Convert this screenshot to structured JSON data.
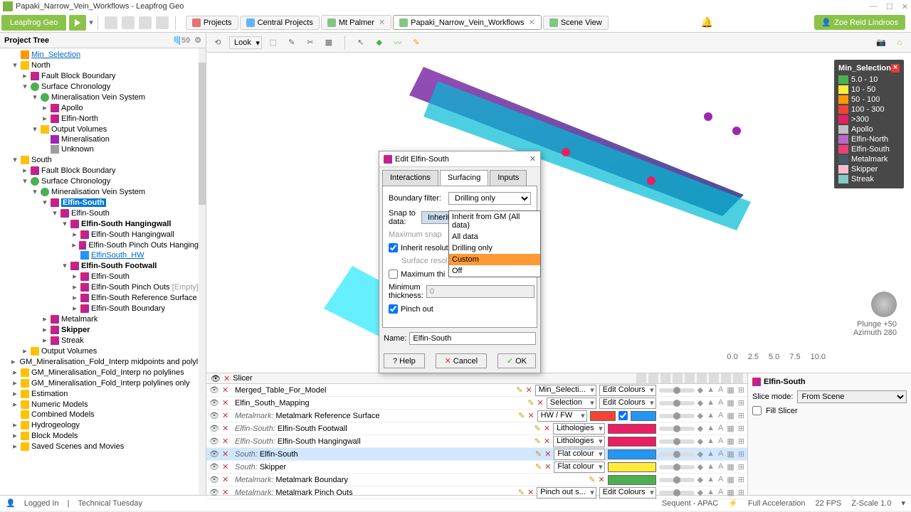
{
  "titlebar": {
    "text": "Papaki_Narrow_Vein_Workflows - Leapfrog Geo"
  },
  "app_badge": "Leapfrog Geo",
  "doc_tabs": [
    {
      "label": "Projects",
      "icon": "#e57373",
      "closable": false
    },
    {
      "label": "Central Projects",
      "icon": "#64b5f6",
      "closable": false
    },
    {
      "label": "Mt Palmer",
      "icon": "#81c784",
      "closable": true
    },
    {
      "label": "Papaki_Narrow_Vein_Workflows",
      "icon": "#81c784",
      "closable": true,
      "active": true
    },
    {
      "label": "Scene View",
      "icon": "#81c784",
      "closable": false
    }
  ],
  "user": "Zoe Reid Lindroos",
  "project_tree": {
    "header": "Project Tree",
    "count": "59"
  },
  "tree_nodes": {
    "min_selection": "Min_Selection",
    "north": "North",
    "fault_block_boundary": "Fault Block Boundary",
    "surface_chronology": "Surface Chronology",
    "mvs": "Mineralisation Vein System",
    "apollo": "Apollo",
    "elfin_north_n": "Elfin-North",
    "output_volumes": "Output Volumes",
    "mineralisation": "Mineralisation",
    "unknown": "Unknown",
    "south": "South",
    "elfin_south": "Elfin-South",
    "elfin_south_hw": "Elfin-South Hangingwall",
    "elfin_south_po_hw": "Elfin-South Pinch Outs Hangingw",
    "elfin_south_hw_link": "ElfinSouth_HW",
    "elfin_south_fw": "Elfin-South Footwall",
    "elfin_south_po": "Elfin-South Pinch Outs",
    "empty": "[Empty]",
    "elfin_south_ref": "Elfin-South Reference Surface",
    "elfin_south_bnd": "Elfin-South Boundary",
    "metalmark": "Metalmark",
    "skipper": "Skipper",
    "streak": "Streak",
    "gm_mid": "GM_Mineralisation_Fold_Interp midpoints and polylines",
    "gm_nopoly": "GM_Mineralisation_Fold_Interp no polylines",
    "gm_poly": "GM_Mineralisation_Fold_Interp polylines only",
    "estimation": "Estimation",
    "numeric_models": "Numeric Models",
    "combined_models": "Combined Models",
    "hydrogeology": "Hydrogeology",
    "block_models": "Block Models",
    "saved_scenes": "Saved Scenes and Movies"
  },
  "scene_toolbar": {
    "look": "Look"
  },
  "legend": {
    "title": "Min_Selection",
    "items": [
      {
        "color": "#4caf50",
        "label": "5.0 - 10"
      },
      {
        "color": "#ffeb3b",
        "label": "10 - 50"
      },
      {
        "color": "#ff9800",
        "label": "50 - 100"
      },
      {
        "color": "#f44336",
        "label": "100 - 300"
      },
      {
        "color": "#e91e63",
        "label": ">300"
      },
      {
        "color": "#c0c0c0",
        "label": "Apollo"
      },
      {
        "color": "#ba68c8",
        "label": "Elfin-North"
      },
      {
        "color": "#ec407a",
        "label": "Elfin-South"
      },
      {
        "color": "#455a64",
        "label": "Metalmark"
      },
      {
        "color": "#f8bbd0",
        "label": "Skipper"
      },
      {
        "color": "#80cbc4",
        "label": "Streak"
      }
    ]
  },
  "compass": {
    "plunge": "Plunge +50",
    "azimuth": "Azimuth 280"
  },
  "scale_ticks": [
    "0.0",
    "2.5",
    "5.0",
    "7.5",
    "10.0"
  ],
  "dialog": {
    "title": "Edit Elfin-South",
    "tabs": [
      "Interactions",
      "Surfacing",
      "Inputs"
    ],
    "active_tab": "Surfacing",
    "boundary_filter_label": "Boundary filter:",
    "boundary_filter_value": "Drilling only",
    "snap_label": "Snap to data:",
    "snap_value": "Inherit from GM (All data)",
    "snap_options": [
      "Inherit from GM (All data)",
      "All data",
      "Drilling only",
      "Custom",
      "Off"
    ],
    "snap_hover": "Custom",
    "max_snap_label": "Maximum snap",
    "inherit_res_label": "Inherit resolut",
    "surface_res_label": "Surface resol",
    "max_thi_label": "Maximum thi",
    "min_thickness_label": "Minimum thickness:",
    "min_thickness_value": "0",
    "pinch_out_label": "Pinch out",
    "name_label": "Name:",
    "name_value": "Elfin-South",
    "help": "Help",
    "cancel": "Cancel",
    "ok": "OK"
  },
  "layers": {
    "slicer": "Slicer",
    "rows": [
      {
        "name": "Merged_Table_For_Model",
        "prefix": "",
        "combo": "Min_Selecti...",
        "colorbtn": "Edit Colours",
        "color": ""
      },
      {
        "name": "Elfin_South_Mapping",
        "prefix": "",
        "combo": "Selection",
        "colorbtn": "Edit Colours",
        "color": ""
      },
      {
        "name": "Metalmark Reference Surface",
        "prefix": "Metalmark:",
        "combo": "HW / FW",
        "colorbtn": "",
        "color": "#f44336",
        "color2": "#2196f3"
      },
      {
        "name": "Elfin-South Footwall",
        "prefix": "Elfin-South:",
        "combo": "Lithologies",
        "colorbtn": "",
        "color": "#e91e63"
      },
      {
        "name": "Elfin-South Hangingwall",
        "prefix": "Elfin-South:",
        "combo": "Lithologies",
        "colorbtn": "",
        "color": "#e91e63"
      },
      {
        "name": "Elfin-South",
        "prefix": "South:",
        "combo": "Flat colour",
        "colorbtn": "",
        "color": "#2196f3",
        "sel": true
      },
      {
        "name": "Skipper",
        "prefix": "South:",
        "combo": "Flat colour",
        "colorbtn": "",
        "color": "#ffeb3b"
      },
      {
        "name": "Metalmark Boundary",
        "prefix": "Metalmark:",
        "combo": "",
        "colorbtn": "",
        "color": "#4caf50"
      },
      {
        "name": "Metalmark Pinch Outs",
        "prefix": "Metalmark:",
        "combo": "Pinch out s...",
        "colorbtn": "Edit Colours",
        "color": ""
      }
    ]
  },
  "props": {
    "title": "Elfin-South",
    "slice_mode_label": "Slice mode:",
    "slice_mode_value": "From Scene",
    "fill_slicer": "Fill Slicer"
  },
  "status": {
    "logged_in": "Logged In",
    "tech_tue": "Technical Tuesday",
    "sequent": "Sequent - APAC",
    "accel": "Full Acceleration",
    "fps": "22 FPS",
    "zscale": "Z-Scale 1.0"
  }
}
